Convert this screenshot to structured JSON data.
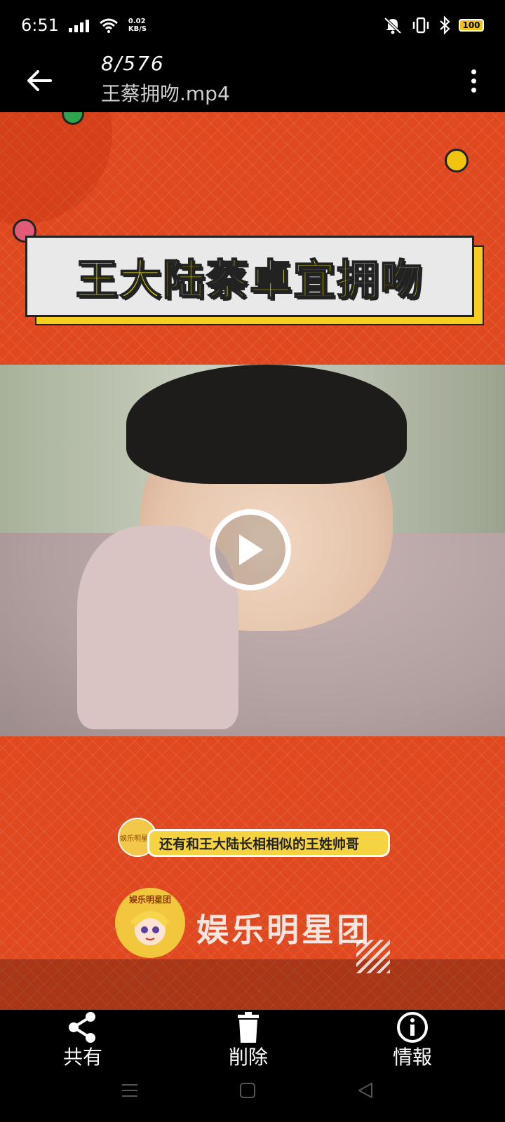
{
  "status_bar": {
    "time": "6:51",
    "net_speed_value": "0.02",
    "net_speed_unit": "KB/S",
    "battery": "100",
    "battery_color": "#f1c40f"
  },
  "app_bar": {
    "counter": "8/576",
    "file_name": "王蔡拥吻.mp4"
  },
  "video": {
    "background_color": "#e0481f",
    "title_banner": "王大陆蔡卓宜拥吻",
    "caption": "还有和王大陆长相相似的王姓帅哥",
    "caption_avatar_text": "娱乐明星团",
    "brand_logo_text": "娱乐明星团",
    "brand_name": "娱乐明星团"
  },
  "actions": [
    {
      "label": "共有",
      "icon": "share-icon"
    },
    {
      "label": "削除",
      "icon": "delete-icon"
    },
    {
      "label": "情報",
      "icon": "info-icon"
    }
  ],
  "nav_bar": [
    "menu-icon",
    "home-icon",
    "back-icon"
  ]
}
